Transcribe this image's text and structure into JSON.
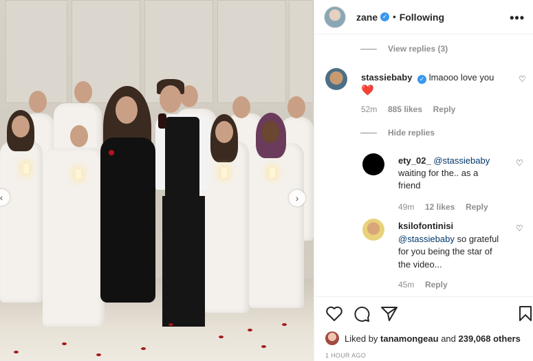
{
  "post": {
    "author": "zane",
    "follow_status": "Following",
    "more_icon": "more-options-icon"
  },
  "comments": {
    "view_replies_1": "View replies (3)",
    "main": {
      "username": "stassiebaby",
      "text": "lmaooo love you",
      "emoji": "❤️",
      "time": "52m",
      "likes": "885 likes",
      "reply": "Reply"
    },
    "hide_replies": "Hide replies",
    "replies": [
      {
        "username": "ety_02_",
        "mention": "@stassiebaby",
        "text_line1": "waiting for the.. as a",
        "text_line2": "friend",
        "time": "49m",
        "likes": "12 likes",
        "reply": "Reply"
      },
      {
        "username": "ksilofontinisi",
        "mention": "@stassiebaby",
        "text_line1": "so grateful",
        "text_line2": "for you being the star of",
        "text_line3": "the video...",
        "time": "45m",
        "reply": "Reply"
      }
    ]
  },
  "footer": {
    "liked_by_prefix": "Liked by",
    "liked_by_user": "tanamongeau",
    "liked_by_and": "and",
    "liked_by_count": "239,068 others",
    "timestamp": "1 HOUR AGO"
  },
  "colors": {
    "verified": "#3897f0",
    "heart_red": "#ed4956",
    "muted_text": "#8e8e8e",
    "mention": "#00376b"
  }
}
